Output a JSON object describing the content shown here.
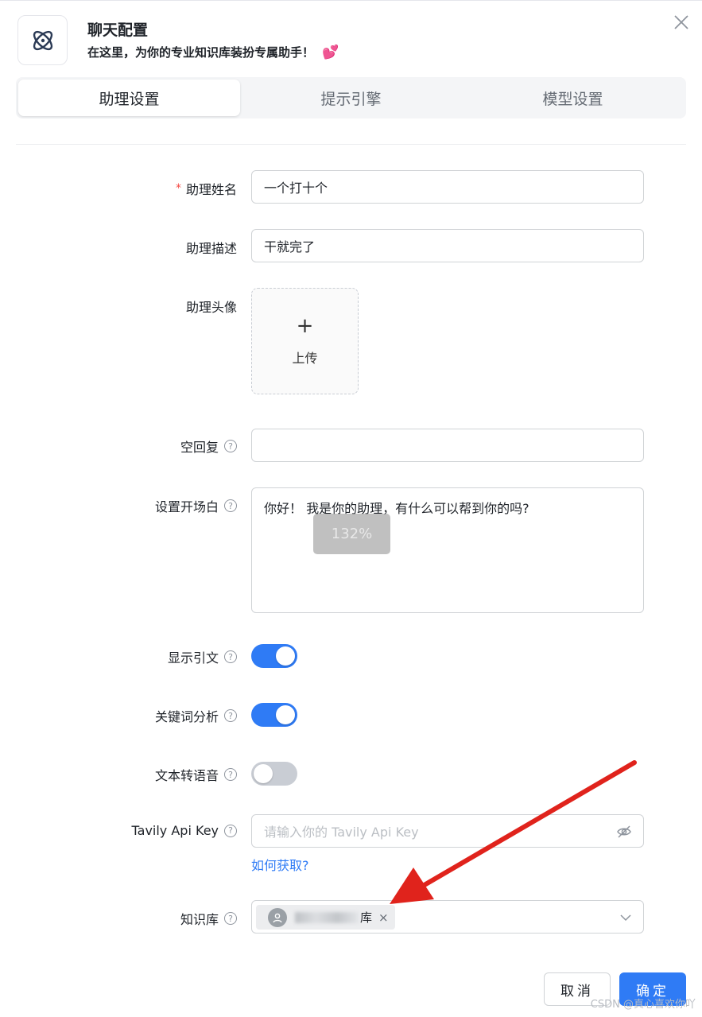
{
  "header": {
    "title": "聊天配置",
    "subtitle": "在这里，为你的专业知识库装扮专属助手！",
    "logo_icon": "atom-icon",
    "heart_glyph": "💕"
  },
  "tabs": [
    {
      "label": "助理设置",
      "active": true
    },
    {
      "label": "提示引擎",
      "active": false
    },
    {
      "label": "模型设置",
      "active": false
    }
  ],
  "form": {
    "name": {
      "label": "助理姓名",
      "required_mark": "*",
      "value": "一个打十个"
    },
    "description": {
      "label": "助理描述",
      "value": "干就完了"
    },
    "avatar": {
      "label": "助理头像",
      "upload_plus": "+",
      "upload_label": "上传"
    },
    "empty_reply": {
      "label": "空回复",
      "value": ""
    },
    "opening": {
      "label": "设置开场白",
      "value": "你好！ 我是你的助理，有什么可以帮到你的吗?"
    },
    "show_citation": {
      "label": "显示引文",
      "enabled": true
    },
    "keyword_analysis": {
      "label": "关键词分析",
      "enabled": true
    },
    "tts": {
      "label": "文本转语音",
      "enabled": false
    },
    "tavily": {
      "label": "Tavily Api Key",
      "placeholder": "请输入你的 Tavily Api Key",
      "link": "如何获取?"
    },
    "knowledge_base": {
      "label": "知识库",
      "tag_visible_suffix": "库",
      "tag_close": "×"
    }
  },
  "help_glyph": "?",
  "zoom_overlay": "132%",
  "footer": {
    "cancel": "取消",
    "confirm": "确定"
  },
  "watermark": "CSDN @真心喜欢你吖",
  "colors": {
    "primary": "#2f7bf5",
    "annotation_arrow": "#e0231c",
    "required": "#f54a45"
  }
}
